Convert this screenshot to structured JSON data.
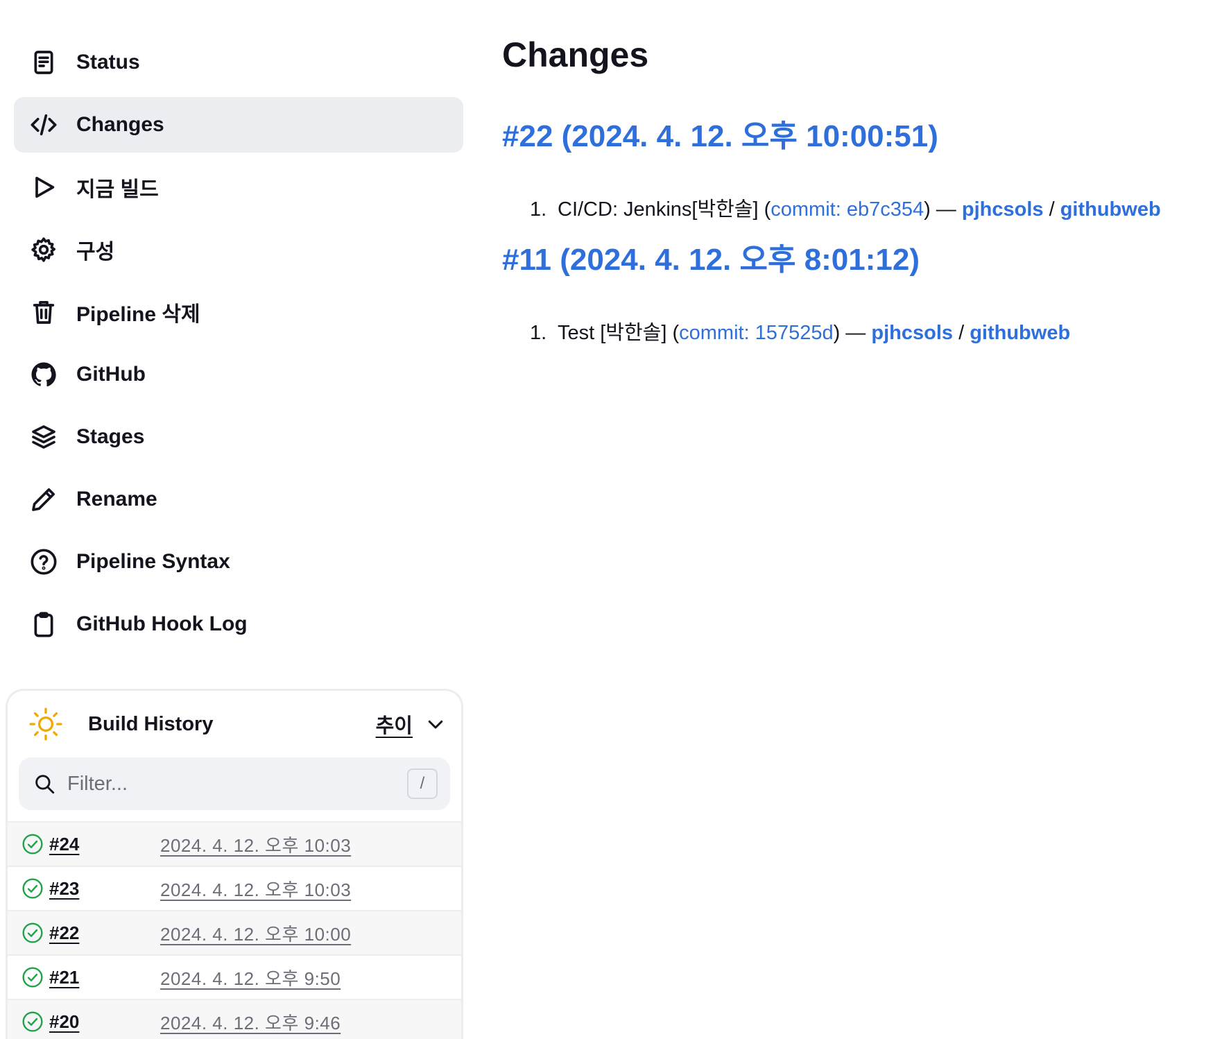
{
  "sidebar": {
    "items": [
      {
        "label": "Status",
        "icon": "document-icon"
      },
      {
        "label": "Changes",
        "icon": "code-icon"
      },
      {
        "label": "지금 빌드",
        "icon": "play-icon"
      },
      {
        "label": "구성",
        "icon": "gear-icon"
      },
      {
        "label": "Pipeline 삭제",
        "icon": "trash-icon"
      },
      {
        "label": "GitHub",
        "icon": "github-icon"
      },
      {
        "label": "Stages",
        "icon": "layers-icon"
      },
      {
        "label": "Rename",
        "icon": "pencil-icon"
      },
      {
        "label": "Pipeline Syntax",
        "icon": "help-icon"
      },
      {
        "label": "GitHub Hook Log",
        "icon": "clipboard-icon"
      }
    ],
    "active_index": 1
  },
  "build_history": {
    "title": "Build History",
    "trend_label": "추이",
    "filter_placeholder": "Filter...",
    "filter_shortcut": "/",
    "builds": [
      {
        "number": "#24",
        "date": "2024. 4. 12. 오후 10:03",
        "status": "success"
      },
      {
        "number": "#23",
        "date": "2024. 4. 12. 오후 10:03",
        "status": "success"
      },
      {
        "number": "#22",
        "date": "2024. 4. 12. 오후 10:00",
        "status": "success"
      },
      {
        "number": "#21",
        "date": "2024. 4. 12. 오후 9:50",
        "status": "success"
      },
      {
        "number": "#20",
        "date": "2024. 4. 12. 오후 9:46",
        "status": "success"
      }
    ]
  },
  "main": {
    "title": "Changes",
    "builds": [
      {
        "heading": "#22 (2024. 4. 12. 오후 10:00:51)",
        "change": {
          "index": "1.",
          "message": "CI/CD: Jenkins[박한솔] (",
          "commit": "commit: eb7c354",
          "sep": ") — ",
          "owner": "pjhcsols",
          "slash": " / ",
          "repo": "githubweb"
        }
      },
      {
        "heading": "#11 (2024. 4. 12. 오후 8:01:12)",
        "change": {
          "index": "1.",
          "message": "Test [박한솔] (",
          "commit": "commit: 157525d",
          "sep": ") — ",
          "owner": "pjhcsols",
          "slash": " / ",
          "repo": "githubweb"
        }
      }
    ]
  },
  "colors": {
    "link": "#2f6fdb",
    "active_bg": "#ebedf1",
    "success": "#1ea446",
    "sun": "#f2a900"
  }
}
